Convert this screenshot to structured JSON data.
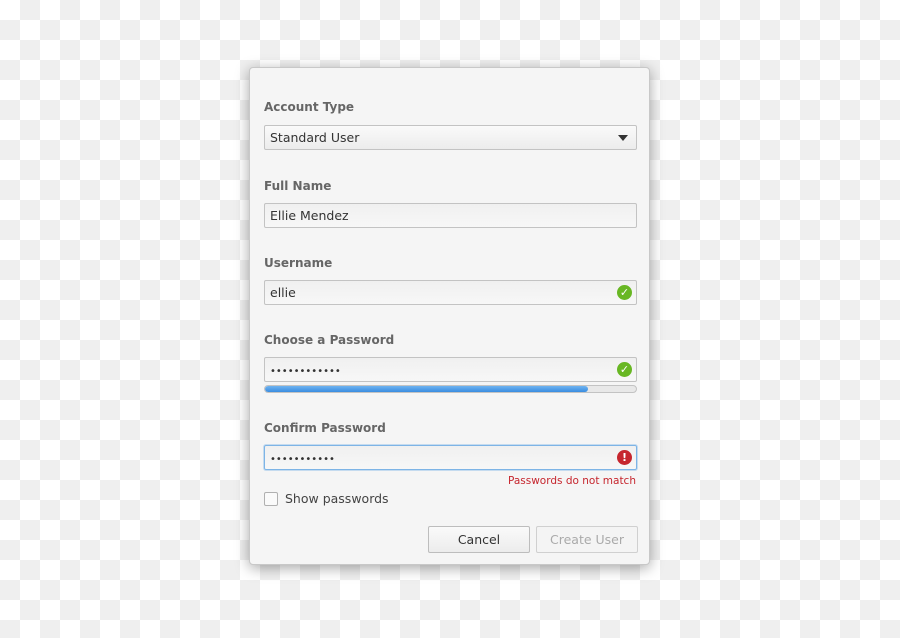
{
  "dialog": {
    "account_type": {
      "label": "Account Type",
      "value": "Standard User"
    },
    "full_name": {
      "label": "Full Name",
      "value": "Ellie Mendez"
    },
    "username": {
      "label": "Username",
      "value": "ellie",
      "status_icon": "check-circle-icon"
    },
    "password": {
      "label": "Choose a Password",
      "value": "••••••••••••",
      "status_icon": "check-circle-icon",
      "strength_percent": 87
    },
    "confirm": {
      "label": "Confirm Password",
      "value": "•••••••••••",
      "status_icon": "error-icon",
      "error": "Passwords do not match"
    },
    "show_passwords": {
      "label": "Show passwords",
      "checked": false
    },
    "buttons": {
      "cancel": "Cancel",
      "create": "Create User"
    },
    "colors": {
      "ok": "#68b723",
      "error": "#c6262e",
      "accent": "#3a8de0"
    }
  }
}
